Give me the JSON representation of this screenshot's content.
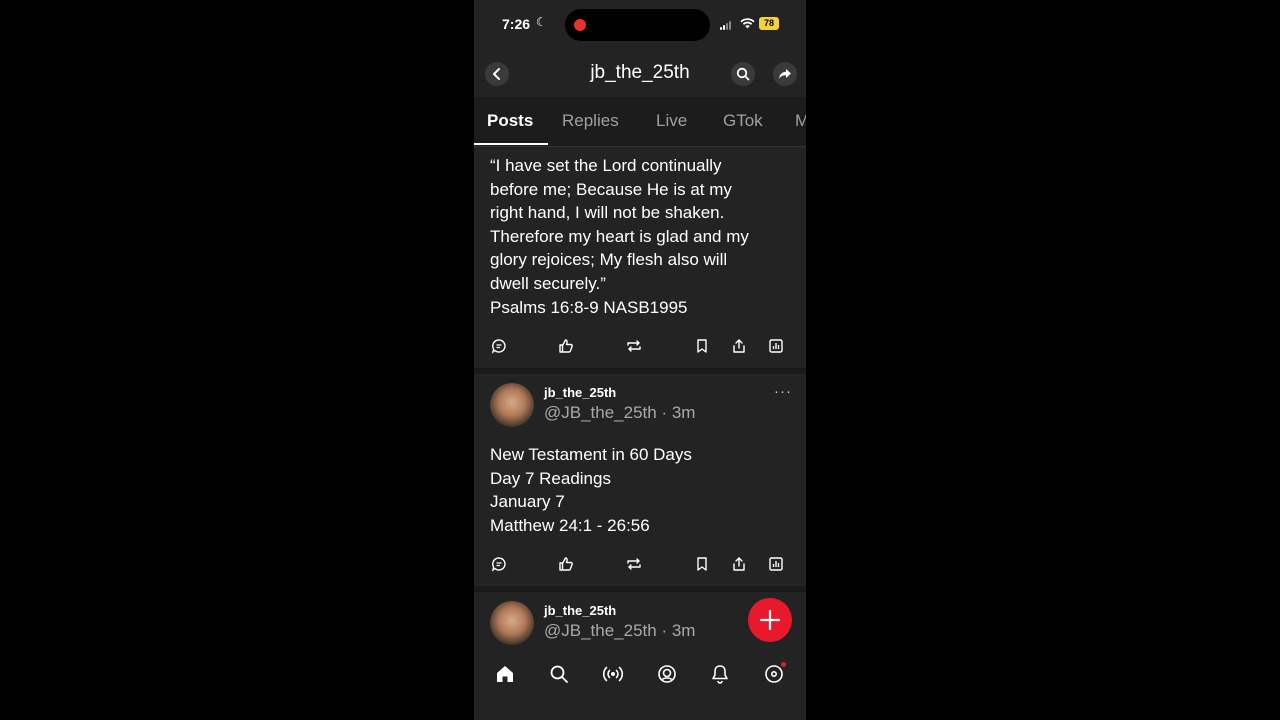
{
  "status_bar": {
    "time": "7:26",
    "battery": "78"
  },
  "header": {
    "title": "jb_the_25th",
    "back_icon": "chevron-left-icon",
    "search_icon": "search-icon",
    "share_icon": "share-arrow-icon"
  },
  "tabs": [
    {
      "label": "Posts",
      "active": true
    },
    {
      "label": "Replies",
      "active": false
    },
    {
      "label": "Live",
      "active": false
    },
    {
      "label": "GTok",
      "active": false
    },
    {
      "label": "M",
      "active": false
    }
  ],
  "posts": [
    {
      "lines": [
        "“I have set the Lord continually",
        "before me; Because He is at my",
        "right hand, I will not be shaken.",
        "Therefore my heart is glad and my",
        "glory rejoices; My flesh also will",
        "dwell securely.”",
        "Psalms 16:8-9 NASB1995"
      ]
    },
    {
      "display_name": "jb_the_25th",
      "handle_time": "@JB_the_25th · 3m",
      "more": "···",
      "lines": [
        "New Testament in 60 Days",
        "Day 7 Readings",
        "January 7",
        "Matthew 24:1 - 26:56"
      ]
    },
    {
      "display_name": "jb_the_25th",
      "handle_time": "@JB_the_25th · 3m"
    }
  ],
  "post_actions": [
    "comment-icon",
    "like-icon",
    "repost-icon",
    "bookmark-icon",
    "share-icon",
    "stats-icon"
  ],
  "bottom_nav": [
    "home-icon",
    "search-icon",
    "live-broadcast-icon",
    "groups-icon",
    "notifications-icon",
    "profile-icon"
  ],
  "colors": {
    "background": "#232323",
    "accent": "#e8192c",
    "muted_text": "#a8a8a8"
  }
}
